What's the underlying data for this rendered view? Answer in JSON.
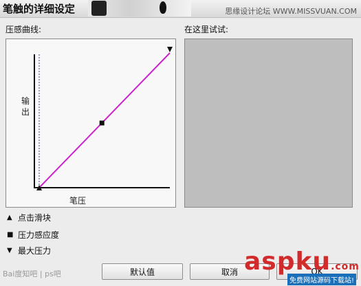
{
  "window": {
    "title": "笔触的详细设定"
  },
  "watermarks": {
    "top_right": "思缘设计论坛 WWW.MISSVUAN.COM",
    "bottom_left": "Bai度知吧 | ps吧",
    "brand": "aspku",
    "brand_suffix": ".com",
    "brand_sub": "免费网站源码下载站!"
  },
  "curve_section": {
    "label": "压感曲线:",
    "y_axis_label": "输出",
    "x_axis_label": "笔压",
    "line_color": "#cc22cc",
    "start_point": [
      0,
      0
    ],
    "mid_point": [
      0.48,
      0.48
    ],
    "end_point": [
      1,
      1
    ]
  },
  "test_section": {
    "label": "在这里试试:"
  },
  "legend": [
    {
      "symbol": "▲",
      "label": "点击滑块"
    },
    {
      "symbol": "■",
      "label": "压力感应度"
    },
    {
      "symbol": "▼",
      "label": "最大压力"
    }
  ],
  "buttons": {
    "default": "默认值",
    "cancel": "取消",
    "ok": "OK"
  }
}
